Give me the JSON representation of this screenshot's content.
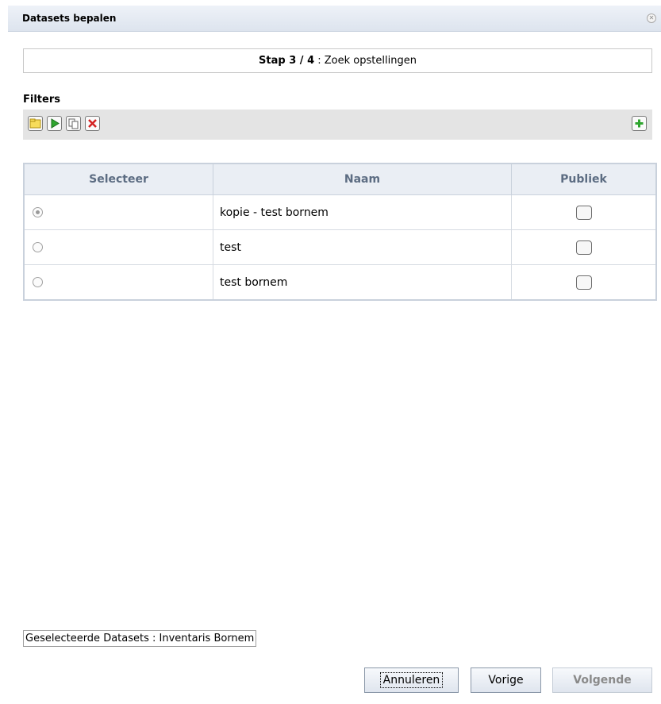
{
  "dialog": {
    "title": "Datasets bepalen",
    "close_icon": "close-icon"
  },
  "step": {
    "label": "Stap 3 / 4",
    "separator": " : ",
    "description": "Zoek opstellingen"
  },
  "filters": {
    "label": "Filters",
    "toolbar_icons": [
      "new-folder-icon",
      "play-icon",
      "copy-icon",
      "delete-icon",
      "add-icon"
    ]
  },
  "table": {
    "headers": [
      "Selecteer",
      "Naam",
      "Publiek"
    ],
    "rows": [
      {
        "name": "kopie - test bornem",
        "selected": true,
        "public": false
      },
      {
        "name": "test",
        "selected": false,
        "public": false
      },
      {
        "name": "test bornem",
        "selected": false,
        "public": false
      }
    ]
  },
  "footer": {
    "selected_datasets": "Geselecteerde Datasets : Inventaris Bornem",
    "buttons": {
      "cancel": "Annuleren",
      "previous": "Vorige",
      "next": "Volgende"
    }
  },
  "colors": {
    "header_text": "#5c6c82",
    "toolbar_bg": "#e4e4e4",
    "titlebar_bg": "#dde4ee"
  }
}
